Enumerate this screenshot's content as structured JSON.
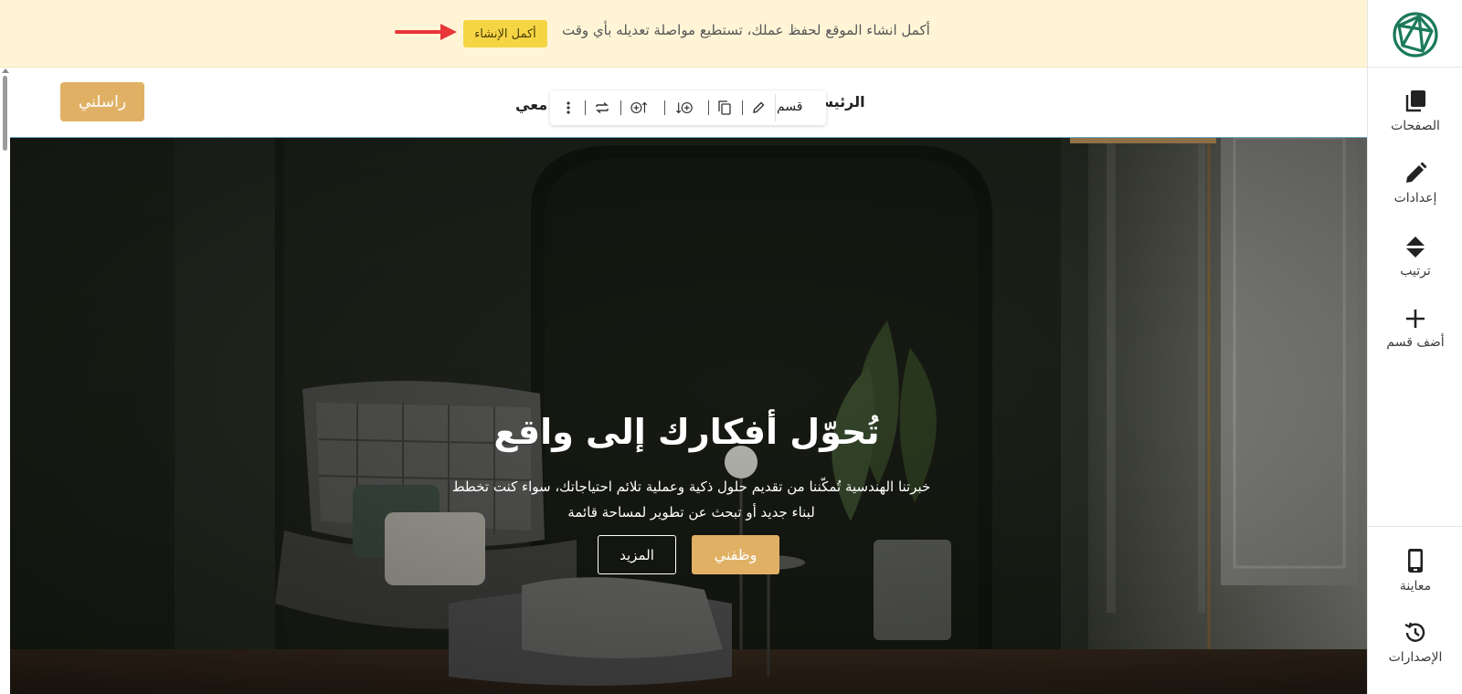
{
  "sidebar": {
    "logo_name": "site-logo",
    "items": [
      {
        "label": "الصفحات",
        "icon": "pages-icon"
      },
      {
        "label": "إعدادات",
        "icon": "pencil-icon"
      },
      {
        "label": "ترتيب",
        "icon": "sort-icon"
      },
      {
        "label": "أضف قسم",
        "icon": "plus-icon"
      }
    ],
    "bottom_items": [
      {
        "label": "معاينة",
        "icon": "mobile-icon"
      },
      {
        "label": "الإصدارات",
        "icon": "history-icon"
      }
    ]
  },
  "notice": {
    "text": "أكمل انشاء الموقع لحفظ عملك، تستطيع مواصلة تعديله بأي وقت",
    "button_label": "أكمل الإنشاء",
    "arrow_color": "#e8353a"
  },
  "site_header": {
    "contact_button": "راسلني",
    "nav_home": "الرئيس",
    "nav_partial": "معي"
  },
  "section_toolbar": {
    "label": "قسم",
    "icons": [
      "edit-icon",
      "duplicate-icon",
      "add-below-icon",
      "add-above-icon",
      "swap-icon",
      "more-icon"
    ]
  },
  "hero": {
    "title": "تُحوّل أفكارك إلى واقع",
    "description": "خبرتنا الهندسية تُمكّننا من تقديم حلول ذكية وعملية تلائم احتياجاتك، سواء كنت تخطط لبناء جديد أو تبحث عن تطوير لمساحة قائمة",
    "primary_button": "وظفني",
    "secondary_button": "المزيد"
  },
  "colors": {
    "accent": "#e0b165",
    "notice_bg": "#fff5d6",
    "notice_button": "#f6d544",
    "logo_green": "#1a7a5a"
  }
}
